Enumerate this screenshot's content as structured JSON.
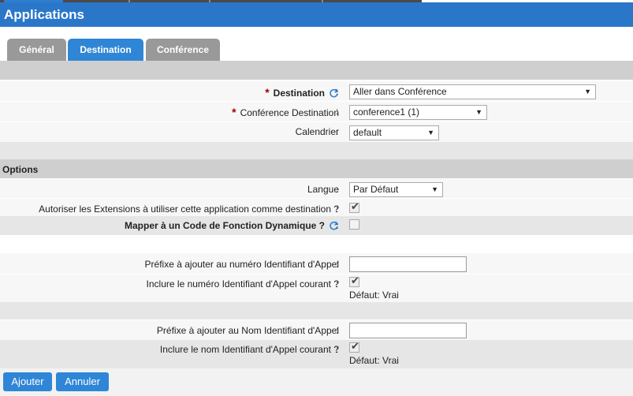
{
  "window": {
    "title": "Applications"
  },
  "tabs": [
    {
      "label": "Général",
      "active": false
    },
    {
      "label": "Destination",
      "active": true
    },
    {
      "label": "Conférence",
      "active": false
    }
  ],
  "fields": {
    "destination": {
      "label": "Destination",
      "required": true,
      "value": "Aller dans Conférence"
    },
    "conference_destination": {
      "label": "Conférence Destination",
      "required": true,
      "value": "conference1 (1)"
    },
    "calendrier": {
      "label": "Calendrier",
      "value": "default"
    }
  },
  "options": {
    "title": "Options",
    "langue": {
      "label": "Langue",
      "value": "Par Défaut"
    },
    "autoriser_extensions": {
      "label": "Autoriser les Extensions à utiliser cette application comme destination ?",
      "checked": true
    },
    "mapper_code": {
      "label": "Mapper à un Code de Fonction Dynamique ?",
      "checked": false
    },
    "prefixe_numero": {
      "label": "Préfixe à ajouter au numéro Identifiant d'Appel",
      "value": ""
    },
    "inclure_numero": {
      "label": "Inclure le numéro Identifiant d'Appel courant ?",
      "checked": true,
      "hint": "Défaut: Vrai"
    },
    "prefixe_nom": {
      "label": "Préfixe à ajouter au Nom Identifiant d'Appel",
      "value": ""
    },
    "inclure_nom": {
      "label": "Inclure le nom Identifiant d'Appel courant ?",
      "checked": true,
      "hint": "Défaut: Vrai"
    }
  },
  "colon": ":",
  "actions": {
    "submit": "Ajouter",
    "cancel": "Annuler"
  },
  "colors": {
    "accent": "#2a77c9",
    "required": "#a00000"
  }
}
